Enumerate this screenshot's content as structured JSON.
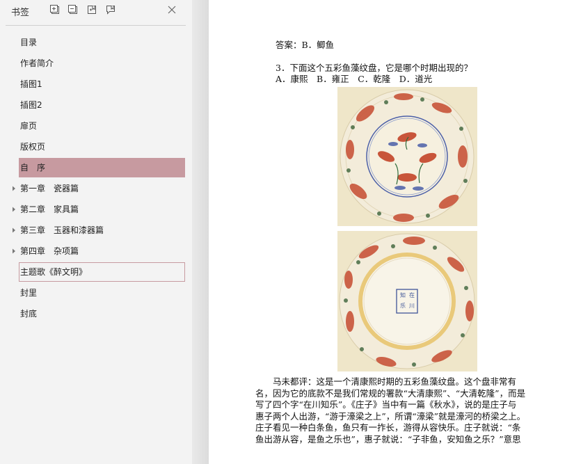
{
  "sidebar": {
    "title": "书签",
    "toolbar_icons": [
      "expand-all-icon",
      "collapse-all-icon",
      "add-bookmark-icon",
      "bookmark-properties-icon"
    ],
    "close_icon": "close-icon",
    "items": [
      {
        "label": "目录",
        "has_children": false
      },
      {
        "label": "作者简介",
        "has_children": false
      },
      {
        "label": "插图1",
        "has_children": false
      },
      {
        "label": "插图2",
        "has_children": false
      },
      {
        "label": "扉页",
        "has_children": false
      },
      {
        "label": "版权页",
        "has_children": false
      },
      {
        "label": "自　序",
        "has_children": false,
        "state": "selected"
      },
      {
        "label": "第一章　瓷器篇",
        "has_children": true
      },
      {
        "label": "第二章　家具篇",
        "has_children": true
      },
      {
        "label": "第三章　玉器和漆器篇",
        "has_children": true
      },
      {
        "label": "第四章　杂项篇",
        "has_children": true
      },
      {
        "label": "主题歌《醉文明》",
        "has_children": false,
        "state": "focused"
      },
      {
        "label": "封里",
        "has_children": false
      },
      {
        "label": "封底",
        "has_children": false
      }
    ]
  },
  "document": {
    "answer": "答案：B．鲫鱼",
    "question": "3．下面这个五彩鱼藻纹盘，它是哪个时期出现的？",
    "options": "A．康熙　B．雍正　C．乾隆　D．道光",
    "plate_top_image": "famille-verte-fish-plate-front",
    "plate_bottom_image": "famille-verte-fish-plate-base",
    "base_mark_chars": [
      "在",
      "川",
      "知",
      "乐"
    ],
    "commentary_lines": [
      "　　马未都评：这是一个清康熙时期的五彩鱼藻纹盘。这个盘非常有",
      "名，因为它的底款不是我们常规的署款“大清康熙”、“大清乾隆”，而是",
      "写了四个字“在川知乐”。《庄子》当中有一篇《秋水》，说的是庄子与",
      "惠子两个人出游，“游于濠梁之上”，所谓“濠梁”就是濠河的桥梁之上。",
      "庄子看见一种白条鱼，鱼只有一拃长，游得从容快乐。庄子就说：“条",
      "鱼出游从容，是鱼之乐也”，惠子就说：“子非鱼，安知鱼之乐？”意思"
    ]
  },
  "colors": {
    "sidebar_bg": "#f3f3f3",
    "selected_bg": "#c79aa0",
    "fish_red": "#c8553a",
    "cobalt": "#4b5fa8",
    "glaze_cream": "#f3ecda"
  }
}
